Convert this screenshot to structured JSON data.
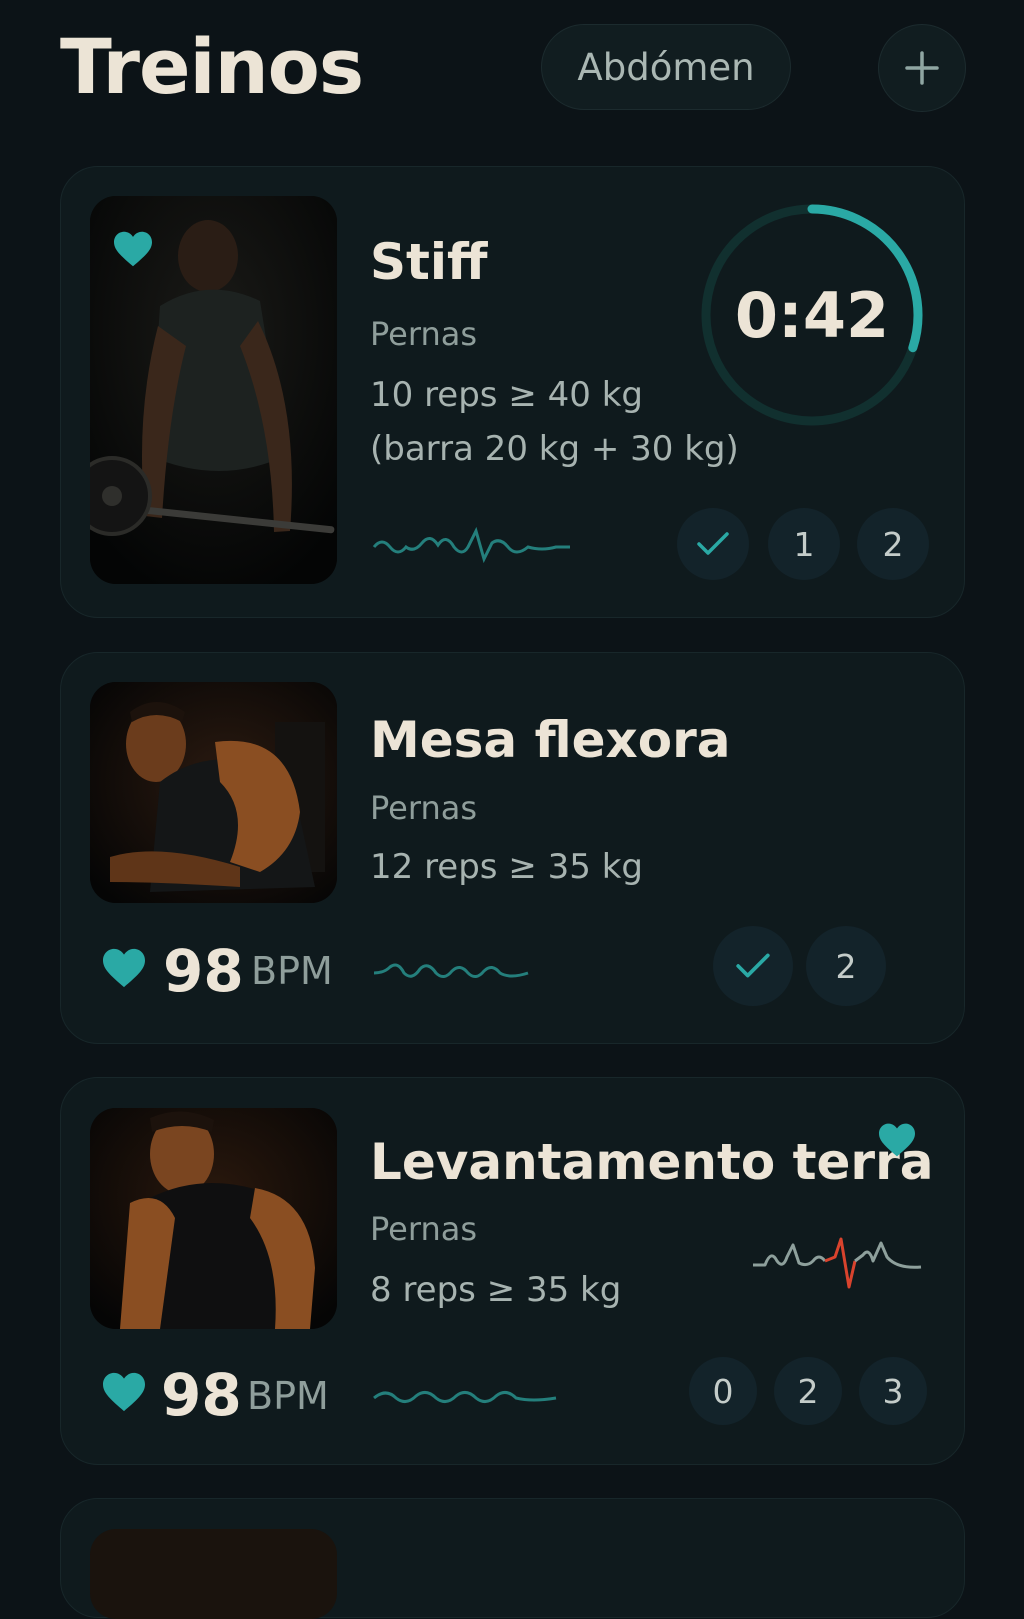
{
  "header": {
    "title": "Treinos",
    "filter_label": "Abdómen",
    "add_label": "+"
  },
  "colors": {
    "accent": "#2aa9a5",
    "background": "#0c1317",
    "card": "#0f1a1d",
    "text": "#ece4d6",
    "muted": "#8f9e9b",
    "alert": "#d9432d"
  },
  "workouts": [
    {
      "name": "Stiff",
      "category": "Pernas",
      "reps": "10 reps ≥ 40 kg",
      "detail": "(barra 20 kg + 30 kg)",
      "timer": "0:42",
      "timer_progress": 0.3,
      "favorite": true,
      "sets": [
        "✓",
        "1",
        "2"
      ]
    },
    {
      "name": "Mesa flexora",
      "category": "Pernas",
      "reps": "12 reps ≥ 35 kg",
      "bpm_value": "98",
      "bpm_unit": "BPM",
      "sets": [
        "✓",
        "2"
      ]
    },
    {
      "name": "Levantamento terra",
      "category": "Pernas",
      "reps": "8 reps ≥ 35 kg",
      "bpm_value": "98",
      "bpm_unit": "BPM",
      "favorite": true,
      "sets": [
        "0",
        "2",
        "3"
      ]
    }
  ]
}
